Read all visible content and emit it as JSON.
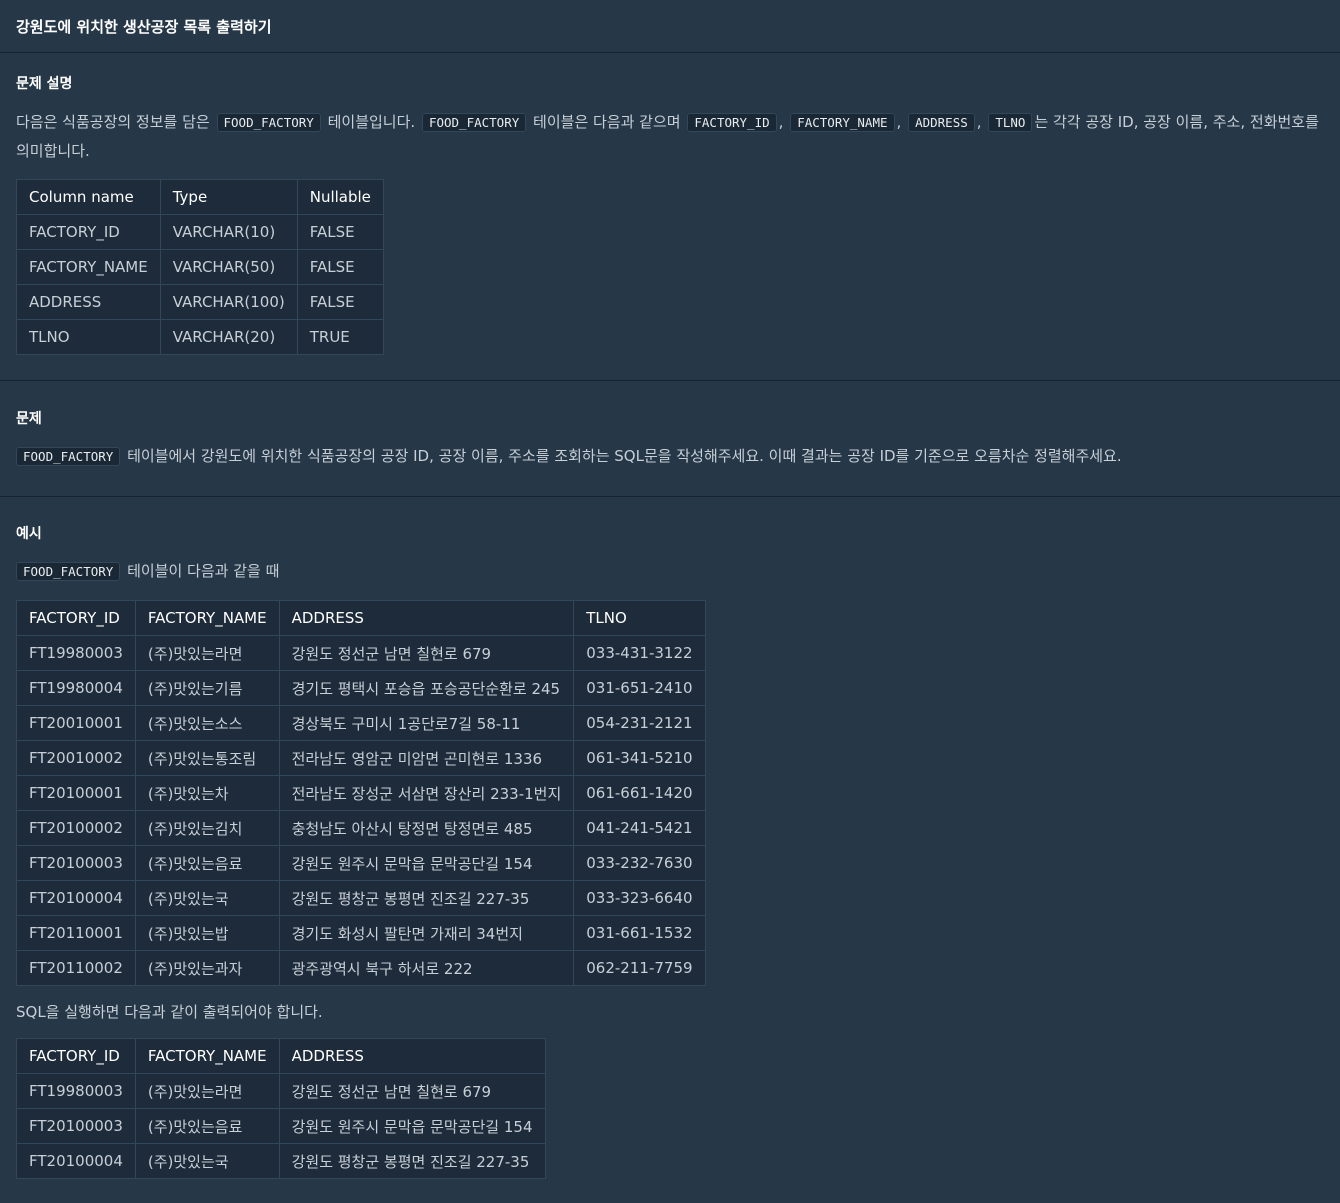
{
  "header": {
    "title": "강원도에 위치한 생산공장 목록 출력하기"
  },
  "description": {
    "heading": "문제 설명",
    "text_1": "다음은 식품공장의 정보를 담은",
    "code_1": "FOOD_FACTORY",
    "text_2": "테이블입니다.",
    "code_2": "FOOD_FACTORY",
    "text_3": "테이블은 다음과 같으며",
    "code_3": "FACTORY_ID",
    "code_4": "FACTORY_NAME",
    "code_5": "ADDRESS",
    "code_6": "TLNO",
    "text_4": "는 각각 공장 ID, 공장 이름, 주소, 전화번호를 의미합니다.",
    "sep": ",",
    "schema_table": {
      "headers": [
        "Column name",
        "Type",
        "Nullable"
      ],
      "rows": [
        [
          "FACTORY_ID",
          "VARCHAR(10)",
          "FALSE"
        ],
        [
          "FACTORY_NAME",
          "VARCHAR(50)",
          "FALSE"
        ],
        [
          "ADDRESS",
          "VARCHAR(100)",
          "FALSE"
        ],
        [
          "TLNO",
          "VARCHAR(20)",
          "TRUE"
        ]
      ]
    }
  },
  "problem": {
    "heading": "문제",
    "code": "FOOD_FACTORY",
    "text": "테이블에서 강원도에 위치한 식품공장의 공장 ID, 공장 이름, 주소를 조회하는 SQL문을 작성해주세요. 이때 결과는 공장 ID를 기준으로 오름차순 정렬해주세요."
  },
  "example": {
    "heading": "예시",
    "code": "FOOD_FACTORY",
    "text": "테이블이 다음과 같을 때",
    "input_table": {
      "headers": [
        "FACTORY_ID",
        "FACTORY_NAME",
        "ADDRESS",
        "TLNO"
      ],
      "rows": [
        [
          "FT19980003",
          "(주)맛있는라면",
          "강원도 정선군 남면 칠현로 679",
          "033-431-3122"
        ],
        [
          "FT19980004",
          "(주)맛있는기름",
          "경기도 평택시 포승읍 포승공단순환로 245",
          "031-651-2410"
        ],
        [
          "FT20010001",
          "(주)맛있는소스",
          "경상북도 구미시 1공단로7길 58-11",
          "054-231-2121"
        ],
        [
          "FT20010002",
          "(주)맛있는통조림",
          "전라남도 영암군 미암면 곤미현로 1336",
          "061-341-5210"
        ],
        [
          "FT20100001",
          "(주)맛있는차",
          "전라남도 장성군 서삼면 장산리 233-1번지",
          "061-661-1420"
        ],
        [
          "FT20100002",
          "(주)맛있는김치",
          "충청남도 아산시 탕정면 탕정면로 485",
          "041-241-5421"
        ],
        [
          "FT20100003",
          "(주)맛있는음료",
          "강원도 원주시 문막읍 문막공단길 154",
          "033-232-7630"
        ],
        [
          "FT20100004",
          "(주)맛있는국",
          "강원도 평창군 봉평면 진조길 227-35",
          "033-323-6640"
        ],
        [
          "FT20110001",
          "(주)맛있는밥",
          "경기도 화성시 팔탄면 가재리 34번지",
          "031-661-1532"
        ],
        [
          "FT20110002",
          "(주)맛있는과자",
          "광주광역시 북구 하서로 222",
          "062-211-7759"
        ]
      ]
    },
    "result_text": "SQL을 실행하면 다음과 같이 출력되어야 합니다.",
    "output_table": {
      "headers": [
        "FACTORY_ID",
        "FACTORY_NAME",
        "ADDRESS"
      ],
      "rows": [
        [
          "FT19980003",
          "(주)맛있는라면",
          "강원도 정선군 남면 칠현로 679"
        ],
        [
          "FT20100003",
          "(주)맛있는음료",
          "강원도 원주시 문막읍 문막공단길 154"
        ],
        [
          "FT20100004",
          "(주)맛있는국",
          "강원도 평창군 봉평면 진조길 227-35"
        ]
      ]
    }
  }
}
